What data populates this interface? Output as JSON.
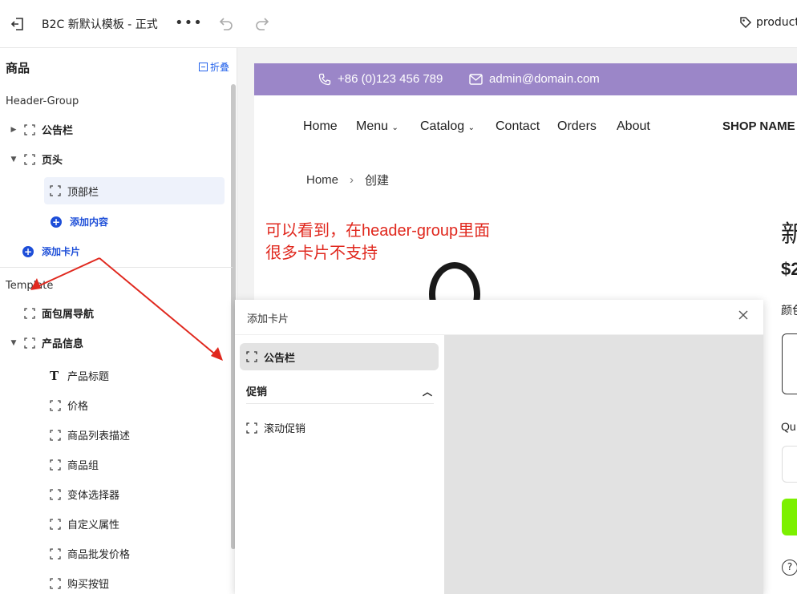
{
  "topbar": {
    "title": "B2C 新默认模板 - 正式",
    "more": "•••",
    "product_label": "product"
  },
  "sidebar": {
    "title": "商品",
    "collapse_label": "折叠",
    "header_group_label": "Header-Group",
    "items_header": [
      {
        "label": "公告栏",
        "caret": "▶"
      },
      {
        "label": "页头",
        "caret": "▼"
      }
    ],
    "selected_child": "顶部栏",
    "add_content": "添加内容",
    "add_card": "添加卡片",
    "template_label": "Template",
    "template_items": [
      {
        "label": "面包屑导航",
        "bold": true
      },
      {
        "label": "产品信息",
        "bold": true,
        "caret": "▼"
      }
    ],
    "product_children": [
      {
        "label": "产品标题",
        "icon": "text-icon"
      },
      {
        "label": "价格",
        "icon": "frame-icon"
      },
      {
        "label": "商品列表描述",
        "icon": "frame-icon"
      },
      {
        "label": "商品组",
        "icon": "frame-icon"
      },
      {
        "label": "变体选择器",
        "icon": "frame-icon"
      },
      {
        "label": "自定义属性",
        "icon": "frame-icon"
      },
      {
        "label": "商品批发价格",
        "icon": "frame-icon"
      },
      {
        "label": "购买按钮",
        "icon": "frame-icon"
      }
    ]
  },
  "preview": {
    "phone": "+86 (0)123 456 789",
    "email": "admin@domain.com",
    "promo_color": "#9b86c8",
    "nav": [
      "Home",
      "Menu",
      "Catalog",
      "Contact",
      "Orders",
      "About"
    ],
    "shop_name": "SHOP NAME",
    "breadcrumb": [
      "Home",
      "创建"
    ],
    "annotation_line1": "可以看到，在header-group里面",
    "annotation_line2": "很多卡片不支持",
    "right_frag_title": "新",
    "right_frag_price": "$2",
    "right_frag_color": "颜色",
    "right_frag_qty": "Qu",
    "help": "?"
  },
  "modal": {
    "title": "添加卡片",
    "active_option": "公告栏",
    "group_title": "促销",
    "group_items": [
      "滚动促销"
    ]
  }
}
